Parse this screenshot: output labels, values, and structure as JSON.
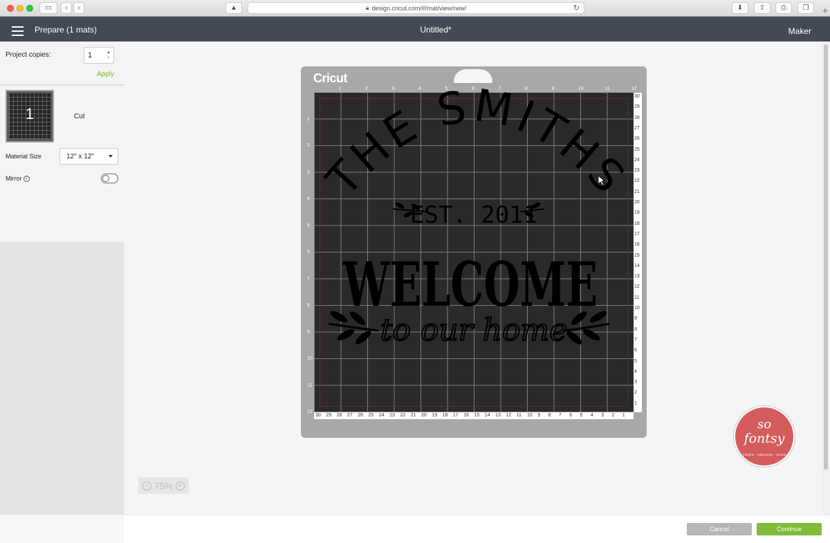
{
  "browser": {
    "url": "design.cricut.com/#/mat/view/new/"
  },
  "header": {
    "prepare_title": "Prepare (1 mats)",
    "document_title": "Untitled*",
    "machine": "Maker"
  },
  "sidebar": {
    "copies_label": "Project copies:",
    "copies_value": "1",
    "apply_label": "Apply",
    "mat_number": "1",
    "mat_mode": "Cut",
    "material_size_label": "Material Size",
    "material_size_value": "12\" x 12\"",
    "mirror_label": "Mirror",
    "mirror_enabled": false
  },
  "mat": {
    "brand": "Cricut",
    "ruler_top": [
      "1",
      "2",
      "3",
      "4",
      "5",
      "6",
      "7",
      "8",
      "9",
      "10",
      "11",
      "12"
    ],
    "ruler_left": [
      "1",
      "2",
      "3",
      "4",
      "5",
      "6",
      "7",
      "8",
      "9",
      "10",
      "11",
      "12"
    ],
    "ruler_right": [
      "30",
      "29",
      "28",
      "27",
      "26",
      "25",
      "24",
      "23",
      "22",
      "21",
      "20",
      "19",
      "18",
      "17",
      "16",
      "15",
      "14",
      "13",
      "12",
      "11",
      "10",
      "9",
      "8",
      "7",
      "6",
      "5",
      "4",
      "3",
      "2",
      "1"
    ],
    "ruler_bottom": [
      "30",
      "29",
      "28",
      "27",
      "26",
      "25",
      "24",
      "23",
      "22",
      "21",
      "20",
      "19",
      "18",
      "17",
      "16",
      "15",
      "14",
      "13",
      "12",
      "11",
      "10",
      "9",
      "8",
      "7",
      "6",
      "5",
      "4",
      "3",
      "2",
      "1"
    ],
    "design": {
      "line1": "THE SMITHS",
      "line2": "EST. 2011",
      "line3": "WELCOME",
      "line4": "to our home"
    }
  },
  "zoom": {
    "level": "75%"
  },
  "watermark": {
    "line1": "so",
    "line2": "fontsy",
    "tagline": "FONTS · DESIGNS · SVGS"
  },
  "footer": {
    "cancel_label": "Cancel",
    "continue_label": "Continue"
  },
  "colors": {
    "header_bg": "#414a55",
    "accent_green": "#80bb3c",
    "mat_bg": "#a8a8a8",
    "grid_bg": "#2a2a2a",
    "watermark_red": "#d55c5c"
  }
}
